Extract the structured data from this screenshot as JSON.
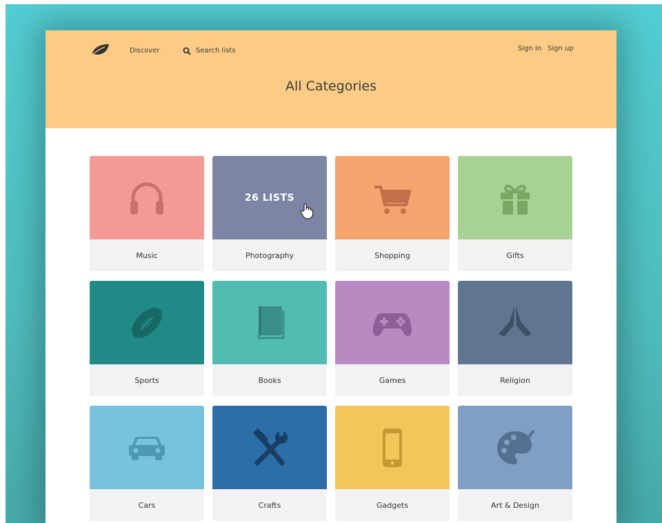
{
  "nav": {
    "discover": "Discover",
    "search": "Search lists",
    "sign_in": "Sign in",
    "sign_up": "Sign up"
  },
  "title": "All Categories",
  "categories": [
    {
      "label": "Music",
      "color": "#f39a96",
      "icon": "headphones-icon"
    },
    {
      "label": "Photography",
      "color": "#7c86a4",
      "icon": "camera-icon",
      "hover_text": "26 LISTS"
    },
    {
      "label": "Shopping",
      "color": "#f5a570",
      "icon": "cart-icon"
    },
    {
      "label": "Gifts",
      "color": "#a8d293",
      "icon": "gift-icon"
    },
    {
      "label": "Sports",
      "color": "#1f8a86",
      "icon": "football-icon"
    },
    {
      "label": "Books",
      "color": "#52bbb2",
      "icon": "book-icon"
    },
    {
      "label": "Games",
      "color": "#b78bc2",
      "icon": "gamepad-icon"
    },
    {
      "label": "Religion",
      "color": "#607690",
      "icon": "praying-hands-icon"
    },
    {
      "label": "Cars",
      "color": "#77c2dc",
      "icon": "car-icon"
    },
    {
      "label": "Crafts",
      "color": "#2d6ea8",
      "icon": "tools-icon"
    },
    {
      "label": "Gadgets",
      "color": "#f1c65a",
      "icon": "phone-icon"
    },
    {
      "label": "Art & Design",
      "color": "#7f9fc4",
      "icon": "palette-icon"
    }
  ],
  "colors": {
    "header": "#fccc86",
    "card_footer": "#f2f2f2",
    "backdrop": "#52cdd3"
  }
}
